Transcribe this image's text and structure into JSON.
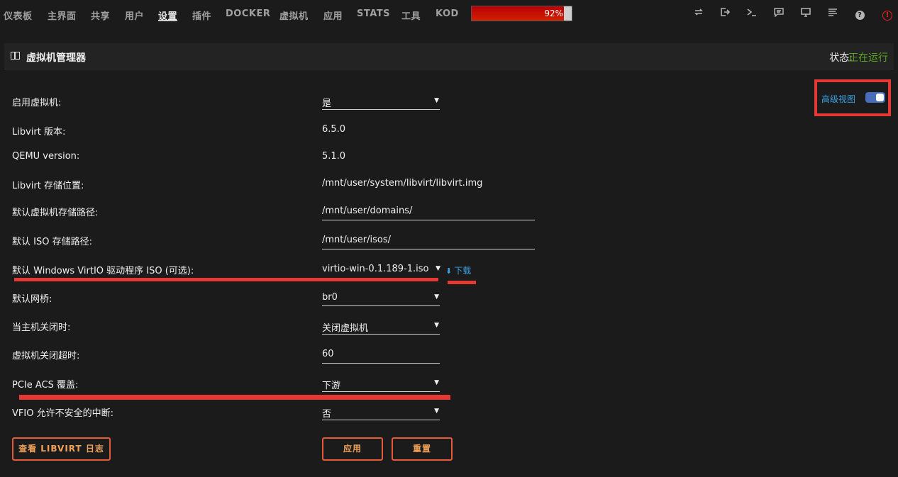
{
  "nav": {
    "items": [
      "仪表板",
      "主界面",
      "共享",
      "用户",
      "设置",
      "插件",
      "DOCKER",
      "虚拟机",
      "应用",
      "STATS",
      "工具",
      "KOD"
    ],
    "active": "设置",
    "usage_percent": 92,
    "usage_label": "92%",
    "icons": [
      "sync-icon",
      "logout-icon",
      "terminal-icon",
      "feedback-icon",
      "monitor-icon",
      "log-icon",
      "help-icon",
      "alert-icon"
    ]
  },
  "panel": {
    "title": "虚拟机管理器",
    "status_label": "状态:",
    "status_value": "正在运行",
    "advanced_view_label": "高级视图",
    "advanced_view_on": true
  },
  "form": {
    "enable_vm": {
      "label": "启用虚拟机:",
      "value": "是"
    },
    "libvirt_version": {
      "label": "Libvirt 版本:",
      "value": "6.5.0"
    },
    "qemu_version": {
      "label": "QEMU version:",
      "value": "5.1.0"
    },
    "libvirt_storage": {
      "label": "Libvirt 存储位置:",
      "value": "/mnt/user/system/libvirt/libvirt.img"
    },
    "default_vm_path": {
      "label": "默认虚拟机存储路径:",
      "value": "/mnt/user/domains/"
    },
    "default_iso_path": {
      "label": "默认 ISO 存储路径:",
      "value": "/mnt/user/isos/"
    },
    "virtio_iso": {
      "label": "默认 Windows VirtIO 驱动程序 ISO (可选):",
      "value": "virtio-win-0.1.189-1.iso",
      "download": "下载"
    },
    "default_bridge": {
      "label": "默认网桥:",
      "value": "br0"
    },
    "host_shutdown": {
      "label": "当主机关闭时:",
      "value": "关闭虚拟机"
    },
    "shutdown_timeout": {
      "label": "虚拟机关闭超时:",
      "value": "60"
    },
    "pcie_acs": {
      "label": "PCIe ACS 覆盖:",
      "value": "下游"
    },
    "vfio_unsafe": {
      "label": "VFIO 允许不安全的中断:",
      "value": "否"
    }
  },
  "buttons": {
    "view_log": "查看 LIBVIRT 日志",
    "apply": "应用",
    "reset": "重置"
  },
  "colors": {
    "accent_orange": "#e55a3a",
    "link_blue": "#3aa0e0",
    "status_green": "#5aa521",
    "highlight_red": "#e53935"
  }
}
